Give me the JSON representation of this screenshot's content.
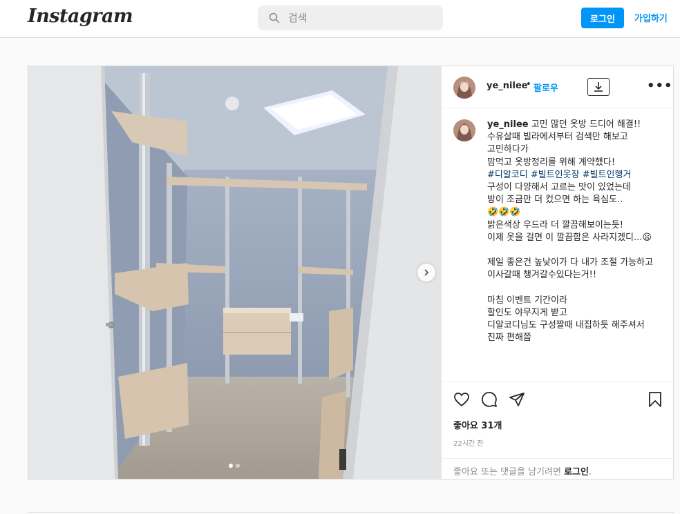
{
  "header": {
    "logo": "Instagram",
    "search_placeholder": "검색",
    "login_label": "로그인",
    "signup_label": "가입하기",
    "accent_color": "#0095f6"
  },
  "post": {
    "username": "ye_nilee",
    "separator": "•",
    "follow_label": "팔로우",
    "more_label": "•••",
    "carousel": {
      "count": 2,
      "active_index": 0
    },
    "caption": {
      "username": "ye_nilee",
      "line1": " 고민 많던 옷방 드디어 해결!!\n수유살때 빌라에서부터 검색만 해보고 고민하다가\n맘먹고 옷방정리를 위해 계약했다!\n",
      "hashtags": "#디알코디 #빌트인옷장 #빌트인행거",
      "line2": "\n구성이 다양해서 고르는 맛이 있었는데\n방이 조금만 더 컸으면 하는 욕심도..\n🤣🤣🤣\n밝은색상 우드라 더 깔끔해보이는듯!\n이제 옷을 걸면 이 깔끔함은 사라지겠디...😦\n\n제일 좋은건 높낮이가 다 내가 조절 가능하고\n이사갈때 챙겨갈수있다는거!!\n\n마침 이벤트 기간이라\n할인도 야무지게 받고\n디알코디님도 구성짤때 내집하듯 해주셔서 진짜 편해쯤"
    },
    "likes_label": "좋아요 31개",
    "time_label": "22시간 전",
    "comment_prompt": "좋아요 또는 댓글을 남기려면 ",
    "comment_login": "로그인",
    "comment_suffix": "."
  }
}
